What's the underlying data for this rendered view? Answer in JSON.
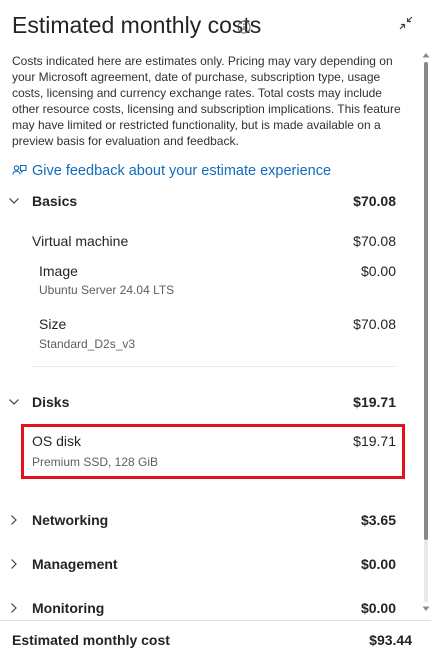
{
  "header": {
    "title": "Estimated monthly costs"
  },
  "disclaimer": "Costs indicated here are estimates only. Pricing may vary depending on your Microsoft agreement, date of purchase, subscription type, usage costs, licensing and currency exchange rates. Total costs may include other resource costs, licensing and subscription implications. This feature may have limited or restricted functionality, but is made available on a preview basis for evaluation and feedback.",
  "feedback_link": "Give feedback about your estimate experience",
  "sections": {
    "basics": {
      "label": "Basics",
      "amount": "$70.08",
      "expanded": true,
      "virtual_machine": {
        "label": "Virtual machine",
        "amount": "$70.08"
      },
      "image": {
        "label": "Image",
        "amount": "$0.00",
        "detail": "Ubuntu Server 24.04 LTS"
      },
      "size": {
        "label": "Size",
        "amount": "$70.08",
        "detail": "Standard_D2s_v3"
      }
    },
    "disks": {
      "label": "Disks",
      "amount": "$19.71",
      "expanded": true,
      "os_disk": {
        "label": "OS disk",
        "amount": "$19.71",
        "detail": "Premium SSD, 128 GiB"
      }
    },
    "networking": {
      "label": "Networking",
      "amount": "$3.65",
      "expanded": false
    },
    "management": {
      "label": "Management",
      "amount": "$0.00",
      "expanded": false
    },
    "monitoring": {
      "label": "Monitoring",
      "amount": "$0.00",
      "expanded": false
    }
  },
  "footer": {
    "label": "Estimated monthly cost",
    "amount": "$93.44"
  },
  "colors": {
    "link": "#0f6cbd",
    "highlight_border": "#e3111f",
    "text": "#242424",
    "subtext": "#605e5c"
  },
  "icons": [
    "info-icon",
    "collapse-icon",
    "feedback-icon",
    "chevron-down-icon",
    "chevron-right-icon"
  ]
}
